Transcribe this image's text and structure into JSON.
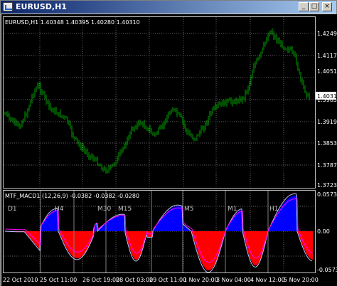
{
  "window": {
    "title": "EURUSD,H1",
    "buttons": {
      "minimize": "_",
      "maximize": "□",
      "close": "×"
    }
  },
  "price_chart": {
    "info": "EURUSD,H1  1.40348 1.40395 1.40280 1.40310",
    "ticks": [
      "1.42490",
      "1.41170",
      "1.40510",
      "1.39850",
      "1.39190",
      "1.38530",
      "1.37870",
      "1.37230"
    ],
    "current_price": "1.40310"
  },
  "indicator": {
    "info": "MTF_MACD1 (12,26,9) -0.0382 -0.0382 -0.0280",
    "ticks": [
      "0.0573",
      "0.00",
      "-0.0573"
    ],
    "timeframes": [
      "D1",
      "H4",
      "M30",
      "M15",
      "M5",
      "M1",
      "H1"
    ]
  },
  "time_axis": [
    "22 Oct 2010",
    "25 Oct 11:00",
    "26 Oct 19:00",
    "28 Oct 03:00",
    "29 Oct 11:00",
    "1 Nov 20:00",
    "3 Nov 04:00",
    "4 Nov 12:00",
    "5 Nov 20:00"
  ],
  "colors": {
    "background": "#000000",
    "candles": "#00a000",
    "hist_positive": "#0000ff",
    "hist_negative": "#ff0000",
    "signal_line": "#ff00ff",
    "macd_line": "#c0c0ff",
    "grid": "#646464",
    "axis_text": "#ffffff"
  }
}
